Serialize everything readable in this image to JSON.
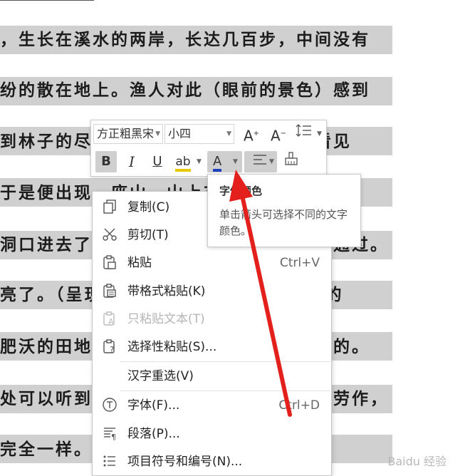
{
  "document": {
    "lines": [
      "，生长在溪水的两岸，长达几百步，中间没有",
      "纷的散在地上。渔人对此（眼前的景色）感到",
      "到林子的尽头，就是溪水的发源地，便看见",
      "于是便出现一座山，山上有个小洞口，里仿",
      "洞口进去了。开始时洞口很窄，仅容一人通过。",
      "亮了。（呈现在眼前的是）土地平坦宽广的",
      "肥沃的田地、美丽的池塘，桑树竹子之类的。",
      "处可以听到鸡鸣狗叫的声音。人们来往种劳作，",
      "完全一样。老人和小孩都十分的愉快，自"
    ]
  },
  "toolbar": {
    "font_name": "方正粗黑宋",
    "font_size": "小四",
    "grow_font": "A",
    "shrink_font": "A",
    "bold": "B",
    "italic": "I",
    "underline": "U",
    "highlight": "ab",
    "font_color": "A",
    "font_color_accent": "#1f3fbf",
    "highlight_accent": "#e8c800"
  },
  "tooltip": {
    "title": "字体颜色",
    "description": "单击箭头可选择不同的文字颜色。"
  },
  "context_menu": {
    "items": [
      {
        "label": "复制(C)",
        "shortcut": "",
        "icon": "copy-icon",
        "disabled": false
      },
      {
        "label": "剪切(T)",
        "shortcut": "",
        "icon": "cut-icon",
        "disabled": false
      },
      {
        "label": "粘贴",
        "shortcut": "Ctrl+V",
        "icon": "paste-icon",
        "disabled": false
      },
      {
        "label": "带格式粘贴(K)",
        "shortcut": "",
        "icon": "paste-format-icon",
        "disabled": false
      },
      {
        "label": "只粘贴文本(T)",
        "shortcut": "",
        "icon": "paste-text-icon",
        "disabled": true
      },
      {
        "label": "选择性粘贴(S)...",
        "shortcut": "",
        "icon": "paste-special-icon",
        "disabled": false
      },
      {
        "label": "汉字重选(V)",
        "shortcut": "",
        "icon": "",
        "disabled": false
      },
      {
        "label": "字体(F)...",
        "shortcut": "Ctrl+D",
        "icon": "font-icon",
        "disabled": false
      },
      {
        "label": "段落(P)...",
        "shortcut": "",
        "icon": "paragraph-icon",
        "disabled": false
      },
      {
        "label": "项目符号和编号(N)...",
        "shortcut": "",
        "icon": "bullets-icon",
        "disabled": false
      }
    ]
  },
  "watermark": "Baidu 经验"
}
